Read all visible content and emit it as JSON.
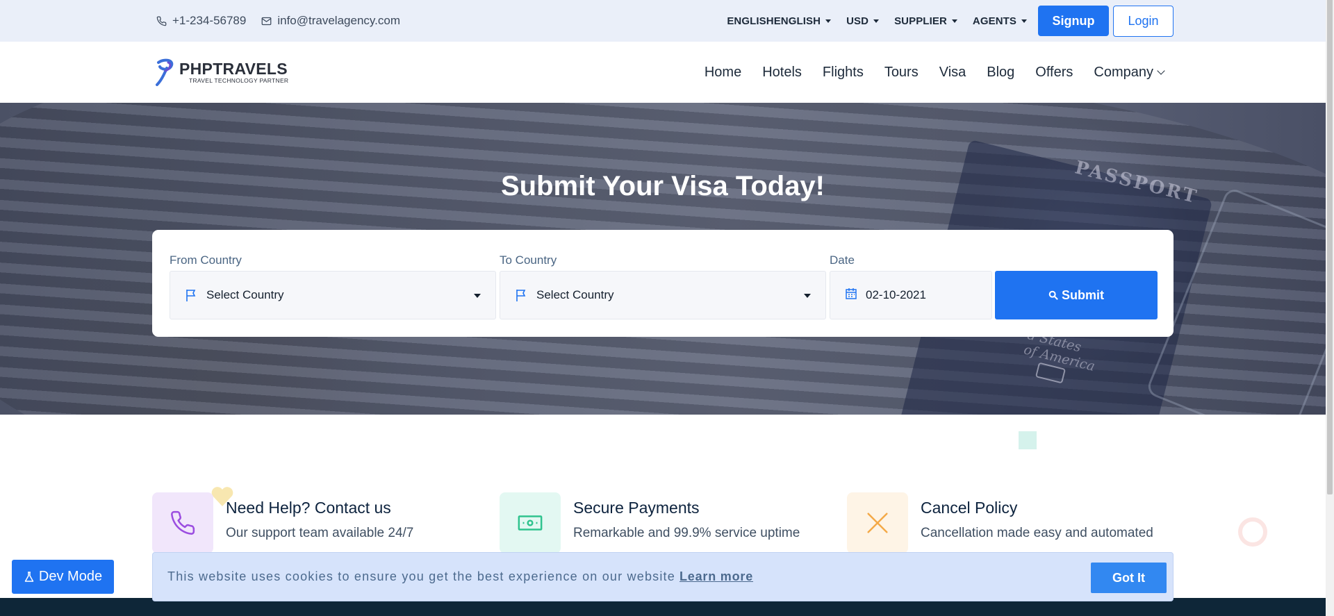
{
  "topbar": {
    "phone": "+1-234-56789",
    "email": "info@travelagency.com",
    "language": "ENGLISHENGLISH",
    "currency": "USD",
    "supplier": "SUPPLIER",
    "agents": "AGENTS",
    "signup": "Signup",
    "login": "Login"
  },
  "brand": {
    "name": "PHPTRAVELS",
    "tagline": "TRAVEL TECHNOLOGY PARTNER"
  },
  "nav": {
    "items": [
      "Home",
      "Hotels",
      "Flights",
      "Tours",
      "Visa",
      "Blog",
      "Offers",
      "Company"
    ]
  },
  "hero": {
    "title": "Submit Your Visa Today!",
    "passport_text": "PASSPORT",
    "passport_sub_line1": "d States",
    "passport_sub_line2": "of America"
  },
  "search": {
    "from_label": "From Country",
    "from_value": "Select Country",
    "to_label": "To Country",
    "to_value": "Select Country",
    "date_label": "Date",
    "date_value": "02-10-2021",
    "submit": "Submit"
  },
  "features": [
    {
      "title": "Need Help? Contact us",
      "desc": "Our support team available 24/7",
      "icon": "phone-icon"
    },
    {
      "title": "Secure Payments",
      "desc": "Remarkable and 99.9% service uptime",
      "icon": "money-icon"
    },
    {
      "title": "Cancel Policy",
      "desc": "Cancellation made easy and automated",
      "icon": "close-icon"
    }
  ],
  "cookie": {
    "message": "This website uses cookies to ensure you get the best experience on our website",
    "learn_more": "Learn more",
    "got_it": "Got It"
  },
  "devmode": {
    "label": "Dev Mode"
  },
  "colors": {
    "primary": "#1f73f1",
    "topbar_bg": "#eaeff9",
    "cookie_bg": "#d6e3fb",
    "footer_bg": "#0e2638"
  }
}
